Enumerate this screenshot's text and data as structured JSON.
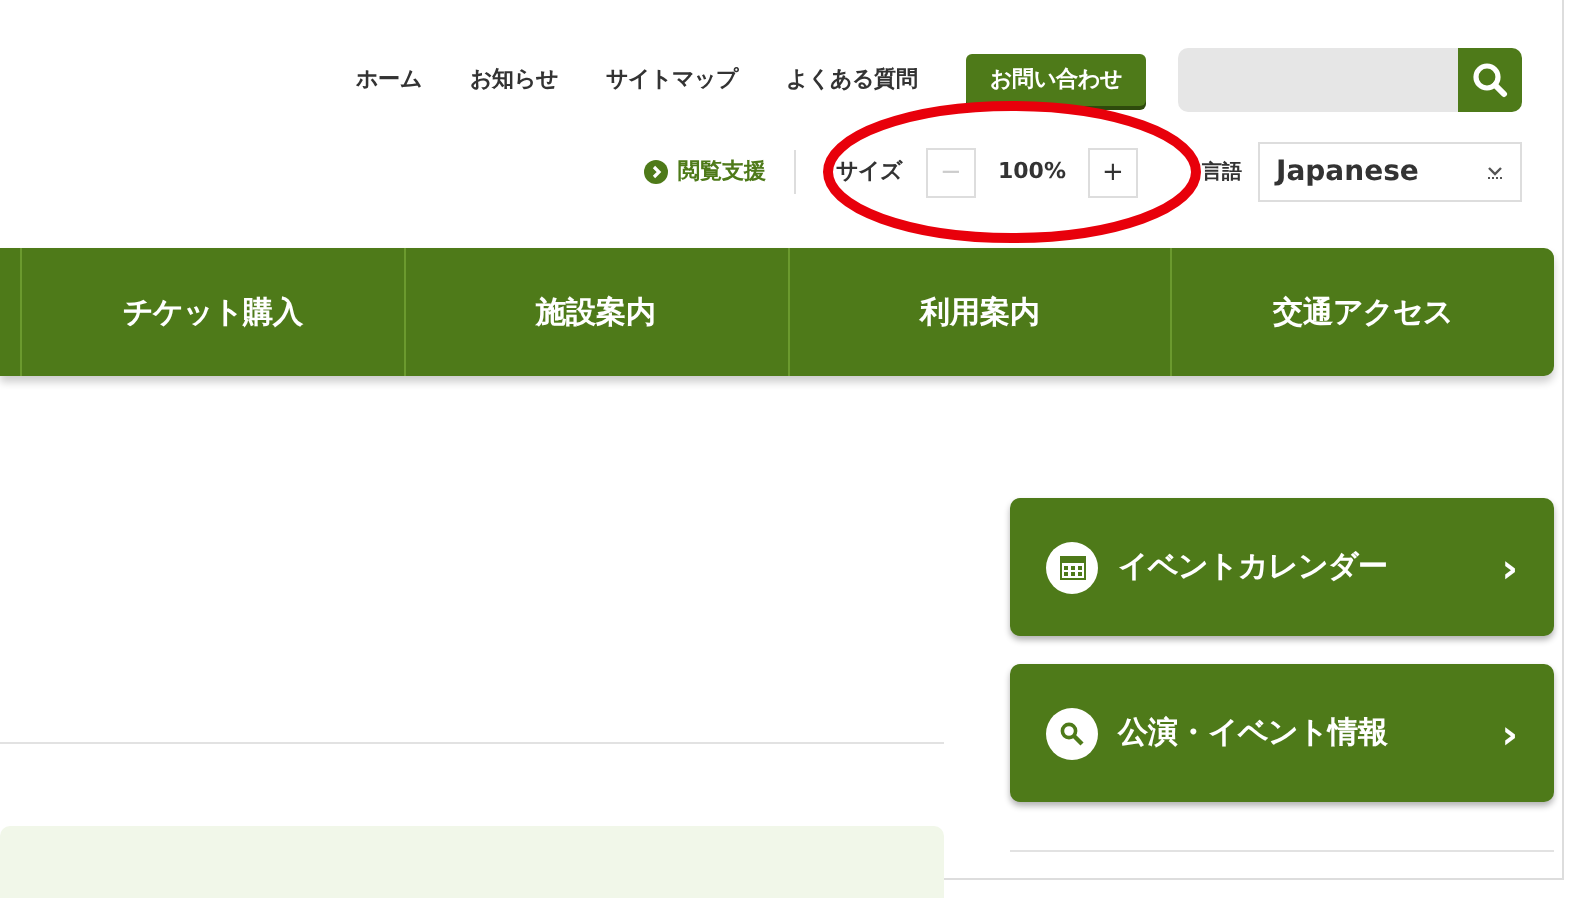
{
  "header_links": [
    "ホーム",
    "お知らせ",
    "サイトマップ",
    "よくある質問"
  ],
  "contact_button": "お問い合わせ",
  "accessibility_link": "閲覧支援",
  "text_size": {
    "label": "サイズ",
    "minus": "−",
    "value": "100%",
    "plus": "+",
    "minus_disabled": true
  },
  "language": {
    "label": "言語",
    "value": "Japanese"
  },
  "nav_tabs": [
    "チケット購入",
    "施設案内",
    "利用案内",
    "交通アクセス"
  ],
  "side_buttons": [
    {
      "kind": "calendar",
      "label": "イベントカレンダー",
      "arrow": "›"
    },
    {
      "kind": "search",
      "label": "公演・イベント情報",
      "arrow": "›"
    }
  ],
  "annotation": {
    "kind": "ellipse"
  }
}
